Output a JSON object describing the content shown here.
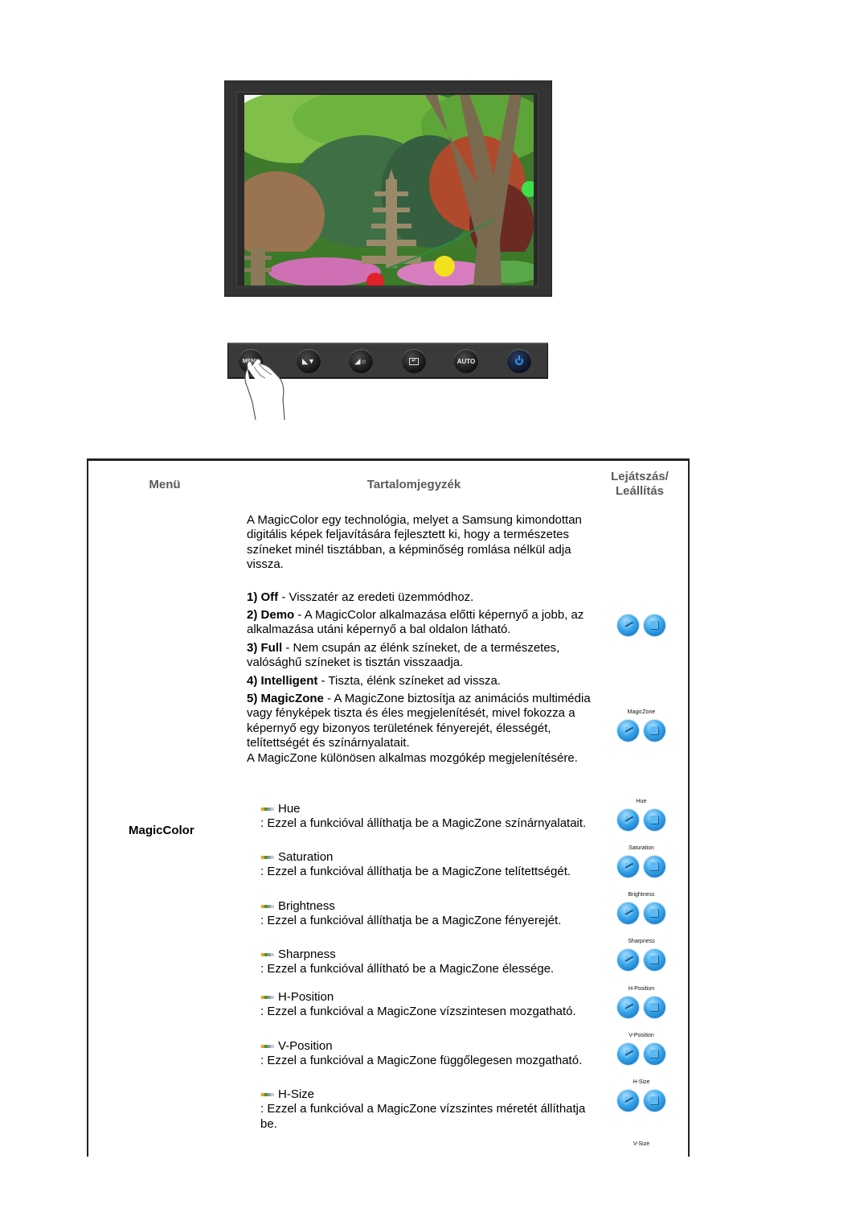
{
  "illustration": {
    "monitor_alt": "Monitor displaying a garden scene with a stone pagoda, trees and lanterns",
    "control_buttons": [
      {
        "id": "menu",
        "label": "MENU",
        "icon": "menu-icon"
      },
      {
        "id": "magicbright",
        "label": "",
        "icon": "magicbright-down-icon"
      },
      {
        "id": "brightness",
        "label": "",
        "icon": "brightness-icon"
      },
      {
        "id": "enter",
        "label": "",
        "icon": "enter-icon"
      },
      {
        "id": "auto",
        "label": "AUTO",
        "icon": "auto-icon"
      },
      {
        "id": "power",
        "label": "",
        "icon": "power-icon"
      }
    ],
    "hand_icon": "pointing-hand-icon"
  },
  "table": {
    "headers": {
      "menu": "Menü",
      "contents": "Tartalomjegyzék",
      "play_line1": "Lejátszás/",
      "play_line2": "Leállítás"
    },
    "menu_item": "MagicColor",
    "intro": "A MagicColor egy technológia, melyet a Samsung kimondottan digitális képek feljavítására fejlesztett ki, hogy a természetes színeket minél tisztábban, a képminőség romlása nélkül adja vissza.",
    "modes": [
      {
        "num": "1)",
        "name": "Off",
        "desc": " - Visszatér az eredeti üzemmódhoz."
      },
      {
        "num": "2)",
        "name": "Demo",
        "desc": " - A MagicColor alkalmazása előtti képernyő a jobb, az alkalmazása utáni képernyő a bal oldalon látható."
      },
      {
        "num": "3)",
        "name": "Full",
        "desc": " - Nem csupán az élénk színeket, de a természetes, valósághű színeket is tisztán visszaadja."
      },
      {
        "num": "4)",
        "name": "Intelligent",
        "desc": " - Tiszta, élénk színeket ad vissza."
      },
      {
        "num": "5)",
        "name": "MagicZone",
        "desc": " - A MagicZone biztosítja az animációs multimédia vagy fényképek tiszta és éles megjelenítését, mivel fokozza a képernyő egy bizonyos területének fényerejét, élességét, telítettségét és színárnyalatait."
      }
    ],
    "magiczone_note": "A MagicZone különösen alkalmas mozgókép megjelenítésére.",
    "sub_items": [
      {
        "title": "Hue",
        "desc": ": Ezzel a funkcióval állíthatja be a MagicZone színárnyalatait."
      },
      {
        "title": "Saturation",
        "desc": ": Ezzel a funkcióval állíthatja be a MagicZone telítettségét."
      },
      {
        "title": "Brightness",
        "desc": ": Ezzel a funkcióval állíthatja be a MagicZone fényerejét."
      },
      {
        "title": "Sharpness",
        "desc": ": Ezzel a funkcióval állítható be a MagicZone élessége."
      },
      {
        "title": "H-Position",
        "desc": ": Ezzel a funkcióval a MagicZone vízszintesen mozgatható."
      },
      {
        "title": "V-Position",
        "desc": ": Ezzel a funkcióval a MagicZone függőlegesen mozgatható."
      },
      {
        "title": "H-Size",
        "desc": ": Ezzel a funkcióval a MagicZone vízszintes méretét állíthatja be."
      }
    ],
    "player_labels": [
      "",
      "MagicZone",
      "Hue",
      "Saturation",
      "Brightness",
      "Sharpness",
      "H-Position",
      "V-Position",
      "H-Size"
    ],
    "trailing_label": "V-Size",
    "bullet_colors": [
      "#f39a1e",
      "#3c9a3c",
      "#9a9a9a",
      "#c8c8f4"
    ]
  }
}
